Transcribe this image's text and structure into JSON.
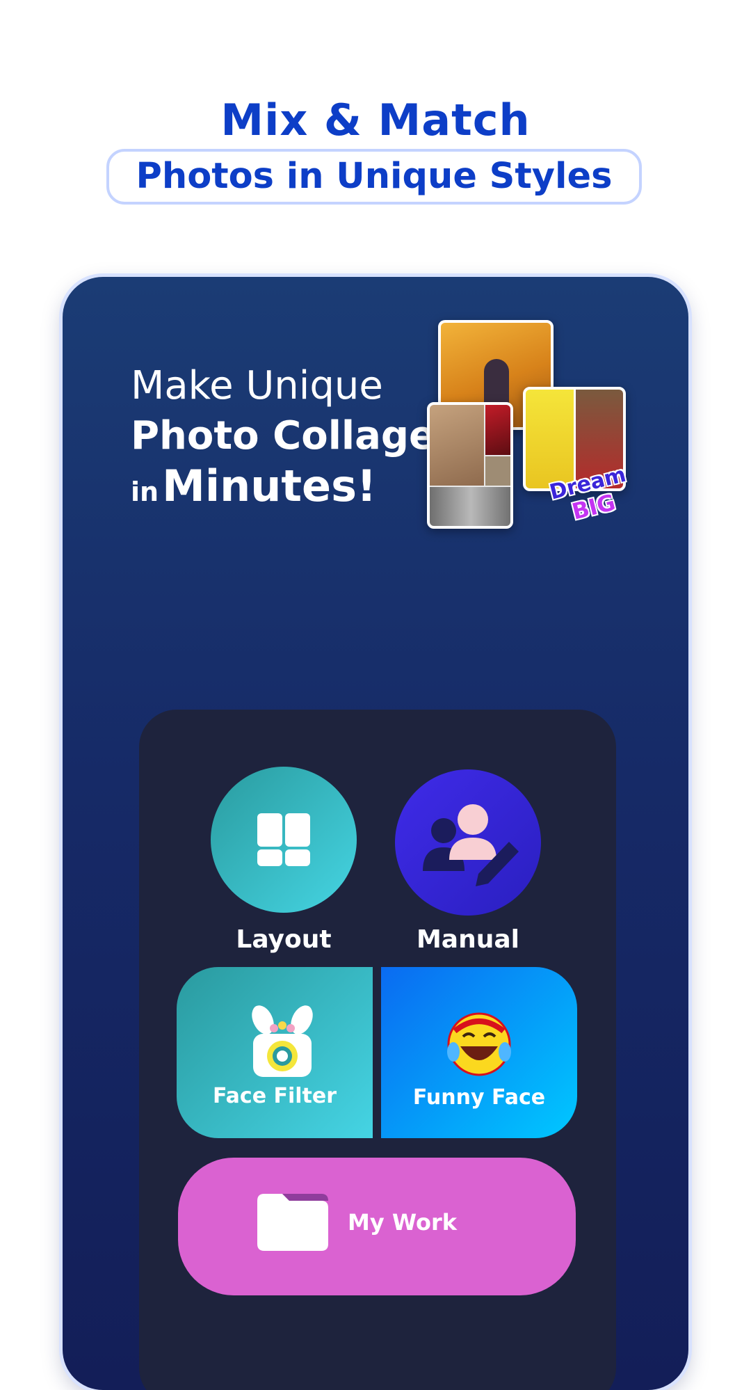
{
  "header": {
    "title": "Mix & Match",
    "subtitle": "Photos in Unique Styles"
  },
  "hero": {
    "line1": "Make Unique",
    "line2": "Photo Collage",
    "line3_prefix": "in",
    "line3_main": "Minutes!",
    "sticker_word1": "Dream",
    "sticker_word2": "BIG"
  },
  "menu": {
    "layout_label": "Layout",
    "manual_label": "Manual",
    "face_filter_label": "Face Filter",
    "funny_face_label": "Funny Face",
    "my_work_label": "My Work"
  },
  "icons": {
    "layout": "grid-layout-icon",
    "manual": "user-edit-icon",
    "face_filter": "bunny-camera-icon",
    "funny_face": "laughing-emoji-icon",
    "my_work": "folder-icon"
  },
  "colors": {
    "title": "#0d3ec7",
    "phone_top": "#1b3c75",
    "phone_bottom": "#131e58",
    "panel": "#1e233d",
    "layout_teal": "#45d5e3",
    "manual_indigo": "#3f2be8",
    "funny_blue": "#00c8ff",
    "my_work_pink": "#da62d1"
  }
}
